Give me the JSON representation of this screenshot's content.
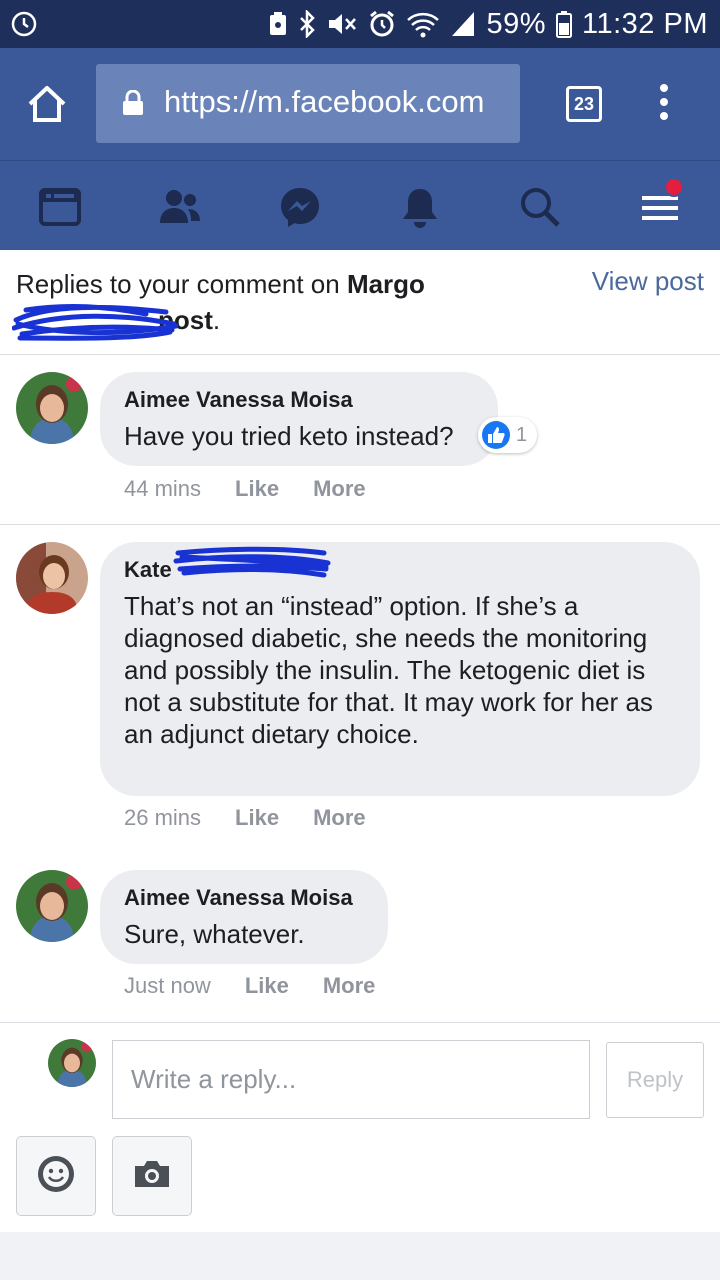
{
  "status_bar": {
    "battery": "59%",
    "time": "11:32 PM",
    "icons": [
      "alarm-icon",
      "nfc-icon",
      "bluetooth-icon",
      "mute-icon",
      "alarm-clock-icon",
      "wifi-icon",
      "signal-icon",
      "battery-icon"
    ]
  },
  "browser": {
    "url": "https://m.facebook.com",
    "tab_count": "23"
  },
  "nav": {
    "items": [
      "news-feed-icon",
      "friends-icon",
      "messenger-icon",
      "notifications-icon",
      "search-icon",
      "menu-icon"
    ]
  },
  "header": {
    "prefix": "Replies to your comment on ",
    "name": "Margo",
    "suffix_bold": "post",
    "suffix": ".",
    "view_post": "View post"
  },
  "comments": [
    {
      "author": "Aimee Vanessa Moisa",
      "text": "Have you tried keto instead?",
      "time": "44 mins",
      "like": "Like",
      "more": "More",
      "reaction_count": "1"
    },
    {
      "author": "Kate",
      "text": "That’s not an “instead” option. If she’s a diagnosed diabetic, she needs the monitoring and possibly the insulin. The ketogenic diet is not a substitute for that. It may work for her as an adjunct dietary choice.",
      "time": "26 mins",
      "like": "Like",
      "more": "More"
    },
    {
      "author": "Aimee Vanessa Moisa",
      "text": "Sure, whatever.",
      "time": "Just now",
      "like": "Like",
      "more": "More"
    }
  ],
  "reply": {
    "placeholder": "Write a reply...",
    "button": "Reply"
  },
  "colors": {
    "fb_blue": "#3b5998",
    "status_bar": "#1f2f5c",
    "notification_red": "#e41e3f"
  }
}
